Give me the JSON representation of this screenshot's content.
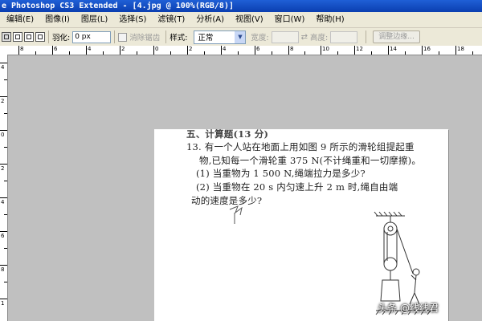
{
  "app": {
    "title": "e Photoshop CS3 Extended - [4.jpg @ 100%(RGB/8)]"
  },
  "menu": {
    "items": [
      "编辑(E)",
      "图像(I)",
      "图层(L)",
      "选择(S)",
      "滤镜(T)",
      "分析(A)",
      "视图(V)",
      "窗口(W)",
      "帮助(H)"
    ]
  },
  "options": {
    "feather_label": "羽化:",
    "feather_value": "0 px",
    "antialias_label": "消除锯齿",
    "style_label": "样式:",
    "style_value": "正常",
    "width_label": "宽度:",
    "height_label": "高度:",
    "refine_button": "调整边缘..."
  },
  "rulers": {
    "top_labels": [
      "8",
      "6",
      "4",
      "2",
      "0",
      "2",
      "4",
      "6",
      "8",
      "10",
      "12",
      "14",
      "16",
      "18"
    ],
    "left_labels": [
      "4",
      "2",
      "0",
      "2",
      "4",
      "6",
      "8",
      "1"
    ]
  },
  "document": {
    "lines": [
      "五、计算题(13 分)",
      "13. 有一个人站在地面上用如图 9 所示的滑轮组提起重",
      "物,已知每一个滑轮重 375 N(不计绳重和一切摩擦)。",
      "(1) 当重物为 1 500 N,绳端拉力是多少?",
      "(2) 当重物在 20 s 内匀速上升 2 m 时,绳自由端",
      "动的速度是多少?"
    ],
    "watermark": "头条 @线线君"
  },
  "colors": {
    "titlebar": "#1f5fd6",
    "chrome": "#ece9d8",
    "canvas_bg": "#c0c0c0"
  }
}
